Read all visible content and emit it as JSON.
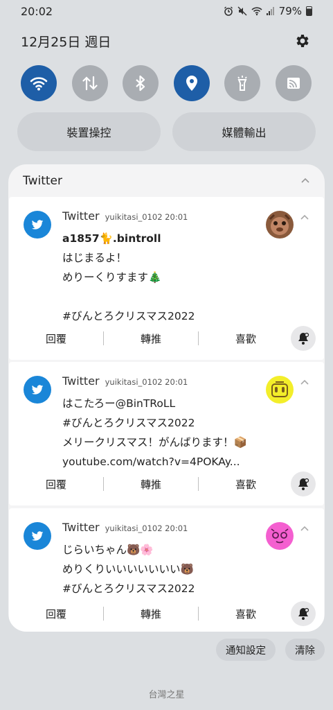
{
  "status_bar": {
    "time": "20:02",
    "battery": "79%",
    "icons": [
      "alarm-icon",
      "mute-icon",
      "wifi-icon",
      "signal-icon",
      "battery-icon"
    ]
  },
  "header": {
    "date": "12月25日 週日"
  },
  "quick_settings": [
    {
      "icon": "wifi-icon",
      "on": true
    },
    {
      "icon": "data-transfer-icon",
      "on": false
    },
    {
      "icon": "bluetooth-icon",
      "on": false
    },
    {
      "icon": "location-icon",
      "on": true
    },
    {
      "icon": "flashlight-icon",
      "on": false
    },
    {
      "icon": "cast-icon",
      "on": false
    }
  ],
  "pills": {
    "device_control": "裝置操控",
    "media_output": "媒體輸出"
  },
  "group_title": "Twitter",
  "notifications": [
    {
      "app": "Twitter",
      "meta": "yuikitasi_0102 20:01",
      "lines": [
        "a1857🐈.bintroll",
        "はじまるよ！",
        "めりーくりすます🎄",
        "",
        "#びんとろクリスマス2022"
      ],
      "actions": [
        "回覆",
        "轉推",
        "喜歡"
      ]
    },
    {
      "app": "Twitter",
      "meta": "yuikitasi_0102 20:01",
      "lines": [
        "はこたろー@BinTRoLL",
        "#びんとろクリスマス2022",
        "メリークリスマス！がんばります！📦",
        "youtube.com/watch?v=4POKAy..."
      ],
      "actions": [
        "回覆",
        "轉推",
        "喜歡"
      ]
    },
    {
      "app": "Twitter",
      "meta": "yuikitasi_0102 20:01",
      "lines": [
        "じらいちゃん🐻🌸",
        "めりくりいいいいいいい🐻",
        "#びんとろクリスマス2022"
      ],
      "actions": [
        "回覆",
        "轉推",
        "喜歡"
      ]
    }
  ],
  "footer": {
    "settings": "通知設定",
    "clear": "清除",
    "carrier": "台灣之星"
  },
  "colors": {
    "accent": "#1e5ea7",
    "twitter": "#1a86d8",
    "panel": "#f4f4f5"
  }
}
